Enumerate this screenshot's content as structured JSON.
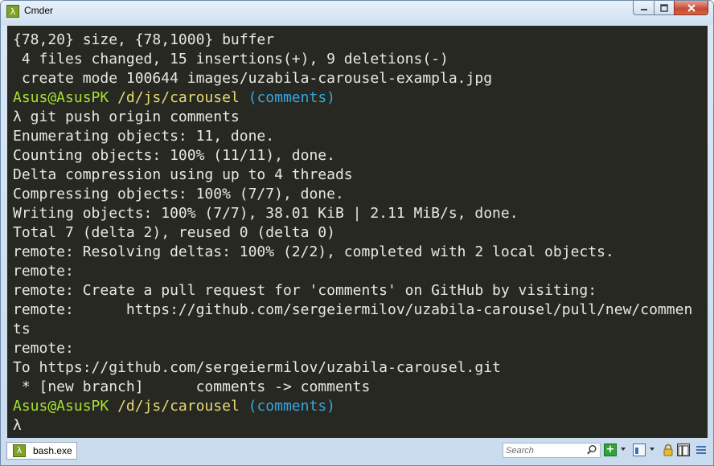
{
  "window": {
    "title": "Cmder",
    "app_icon": "λ",
    "controls": {
      "minimize": "▭",
      "maximize": "▢",
      "close": "✕"
    }
  },
  "console": {
    "colors": {
      "background": "#272822",
      "text": "#e8e8e2",
      "user": "#a6e22e",
      "path": "#e6db74",
      "branch": "#34a8e0"
    },
    "lines": [
      "{78,20} size, {78,1000} buffer",
      " 4 files changed, 15 insertions(+), 9 deletions(-)",
      " create mode 100644 images/uzabila-carousel-exampla.jpg",
      {
        "user": "Asus@AsusPK",
        "path": "/d/js/carousel",
        "branch": "(comments)"
      },
      "λ git push origin comments",
      "Enumerating objects: 11, done.",
      "Counting objects: 100% (11/11), done.",
      "Delta compression using up to 4 threads",
      "Compressing objects: 100% (7/7), done.",
      "Writing objects: 100% (7/7), 38.01 KiB | 2.11 MiB/s, done.",
      "Total 7 (delta 2), reused 0 (delta 0)",
      "remote: Resolving deltas: 100% (2/2), completed with 2 local objects.",
      "remote:",
      "remote: Create a pull request for 'comments' on GitHub by visiting:",
      "remote:      https://github.com/sergeiermilov/uzabila-carousel/pull/new/commen",
      "ts",
      "remote:",
      "To https://github.com/sergeiermilov/uzabila-carousel.git",
      " * [new branch]      comments -> comments",
      {
        "user": "Asus@AsusPK",
        "path": "/d/js/carousel",
        "branch": "(comments)"
      },
      "λ"
    ]
  },
  "statusbar": {
    "tab": {
      "icon": "λ",
      "label": "bash.exe"
    },
    "search": {
      "placeholder": "Search"
    },
    "new_console_glyph": "+",
    "icons": [
      "new-console-icon",
      "split-icon",
      "lock-icon",
      "pane-icon",
      "menu-icon"
    ]
  }
}
